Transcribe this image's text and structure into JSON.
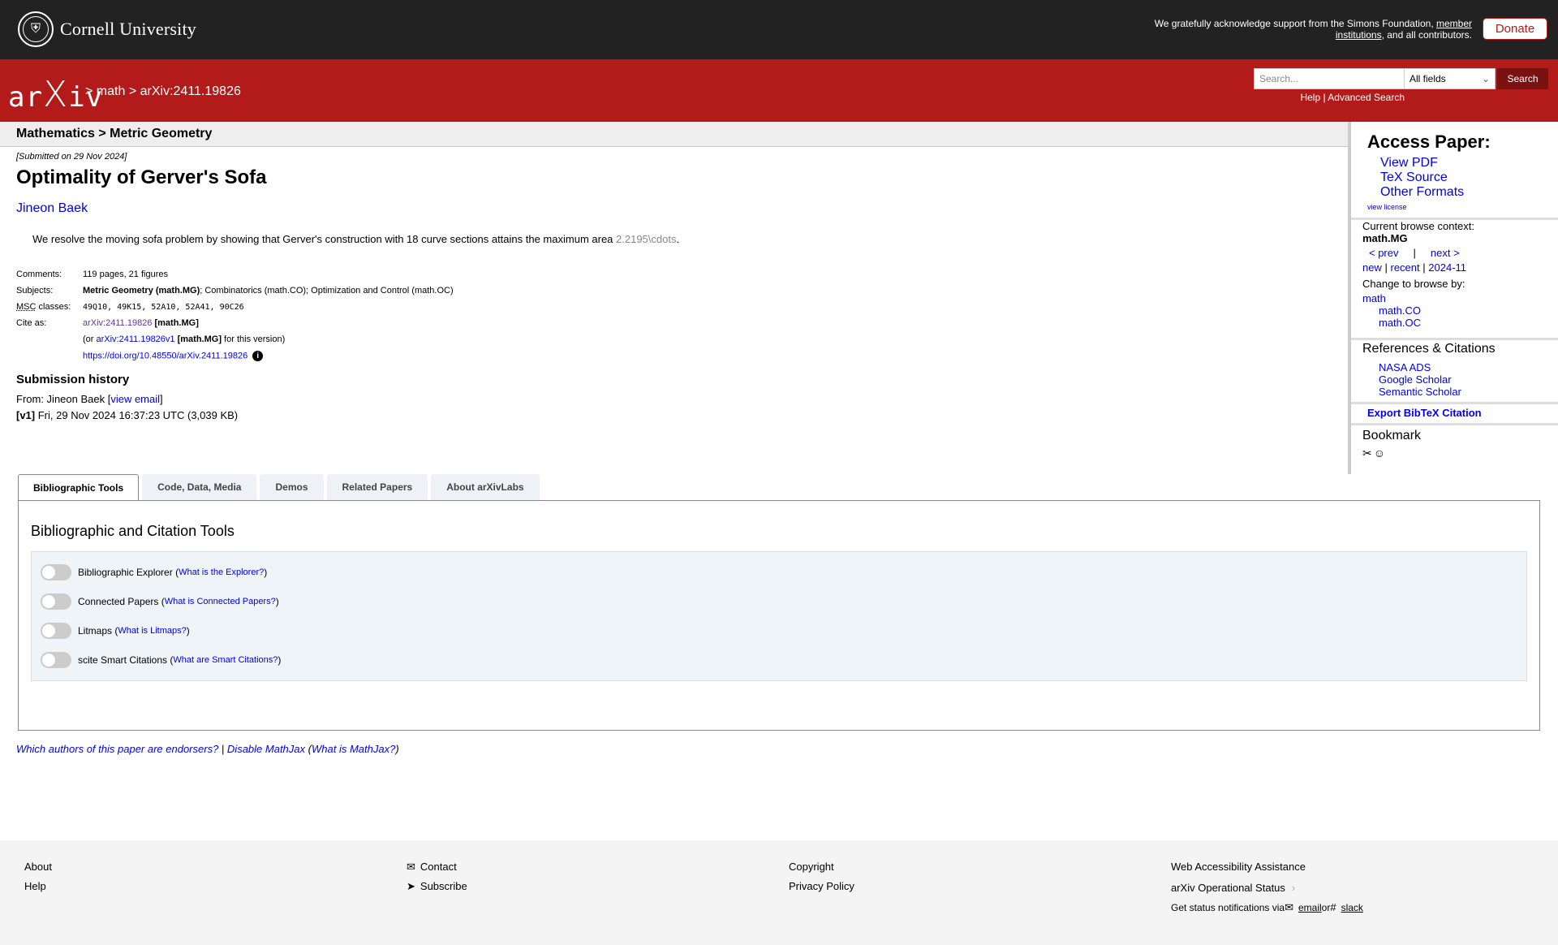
{
  "banner": {
    "brand": "Cornell University",
    "support_text_1": "We gratefully acknowledge support from the Simons Foundation, ",
    "support_link": "member institutions",
    "support_text_2": ", and all contributors.",
    "donate_label": "Donate"
  },
  "header": {
    "logo_text_a": "ar",
    "logo_text_x": "X",
    "logo_text_b": "iv",
    "breadcrumb_sep": ">",
    "breadcrumb_1": "math",
    "breadcrumb_2": "arXiv:2411.19826",
    "search_placeholder": "Search...",
    "search_field_selected": "All fields",
    "search_button": "Search",
    "help_link": "Help",
    "help_sep": "|",
    "advanced_link": "Advanced Search"
  },
  "paper": {
    "subheader": "Mathematics > Metric Geometry",
    "dateline": "[Submitted on 29 Nov 2024]",
    "title": "Optimality of Gerver's Sofa",
    "author": "Jineon Baek",
    "abstract_text": "We resolve the moving sofa problem by showing that Gerver's construction with 18 curve sections attains the maximum area ",
    "abstract_math": "2.2195\\cdots",
    "abstract_end": ".",
    "comments_label": "Comments:",
    "comments": "119 pages, 21 figures",
    "subjects_label": "Subjects:",
    "subjects_primary": "Metric Geometry (math.MG)",
    "subjects_rest": "; Combinatorics (math.CO); Optimization and Control (math.OC)",
    "msc_abbr": "MSC",
    "msc_label_rest": " classes:",
    "msc": "49Q10, 49K15, 52A10, 52A41, 90C26",
    "cite_label": "Cite as:",
    "cite_id": "arXiv:2411.19826",
    "cite_cat": "[math.MG]",
    "cite_or": "(or ",
    "cite_v1": "arXiv:2411.19826v1",
    "cite_v1_cat": "[math.MG]",
    "cite_for": " for this version)",
    "doi": "https://doi.org/10.48550/arXiv.2411.19826",
    "info_icon": "i",
    "history_heading": "Submission history",
    "from_text": "From: Jineon Baek [",
    "view_email": "view email",
    "from_close": "]",
    "v1_label": "[v1]",
    "v1_text": " Fri, 29 Nov 2024 16:37:23 UTC (3,039 KB)"
  },
  "sidebar": {
    "access_heading": "Access Paper:",
    "view_pdf": "View PDF",
    "tex_source": "TeX Source",
    "other_formats": "Other Formats",
    "view_license": "view license",
    "browse_context_label": "Current browse context:",
    "browse_context": "math.MG",
    "prev": "< prev",
    "nav_sep": "|",
    "next": "next >",
    "new": "new",
    "recent": "recent",
    "month": "2024-11",
    "change_label": "Change to browse by:",
    "browse_math": "math",
    "browse_co": "math.CO",
    "browse_oc": "math.OC",
    "refs_heading": "References & Citations",
    "nasa": "NASA ADS",
    "google": "Google Scholar",
    "semantic": "Semantic Scholar",
    "bibtex": "Export BibTeX Citation",
    "bookmark_heading": "Bookmark"
  },
  "labs": {
    "tabs": [
      "Bibliographic Tools",
      "Code, Data, Media",
      "Demos",
      "Related Papers",
      "About arXivLabs"
    ],
    "panel_heading": "Bibliographic and Citation Tools",
    "tools": [
      {
        "name": "Bibliographic Explorer",
        "link": "What is the Explorer?"
      },
      {
        "name": "Connected Papers",
        "link": "What is Connected Papers?"
      },
      {
        "name": "Litmaps",
        "link": "What is Litmaps?"
      },
      {
        "name": "scite Smart Citations",
        "link": "What are Smart Citations?"
      }
    ]
  },
  "endorse": {
    "endorsers": "Which authors of this paper are endorsers?",
    "sep": " | ",
    "disable": "Disable MathJax",
    "what": "What is MathJax?"
  },
  "footer": {
    "about": "About",
    "help": "Help",
    "contact": "Contact",
    "subscribe": "Subscribe",
    "copyright": "Copyright",
    "privacy": "Privacy Policy",
    "accessibility": "Web Accessibility Assistance",
    "status": "arXiv Operational Status",
    "notify": "Get status notifications via ",
    "email": "email",
    "or": " or ",
    "slack": "slack"
  },
  "colors": {
    "arxiv_red": "#b31b1b",
    "banner_black": "#222222",
    "link_blue": "#0000ee"
  }
}
